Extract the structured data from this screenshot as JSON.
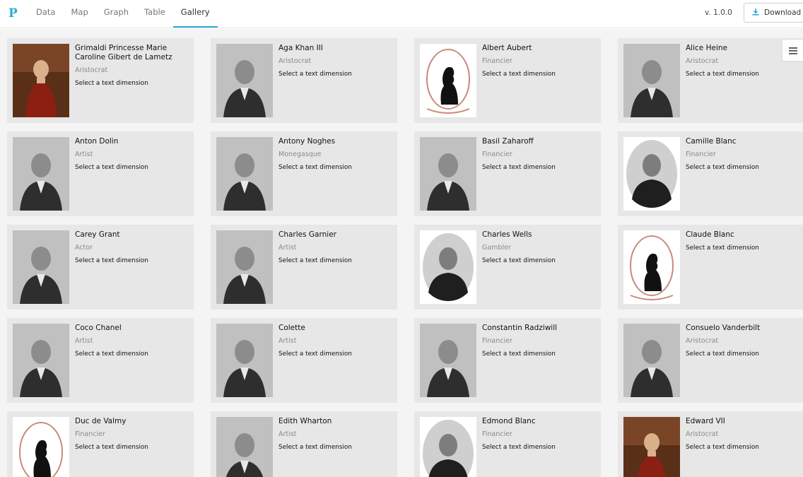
{
  "app": {
    "logo_text": "P",
    "version": "v. 1.0.0",
    "download_label": "Download",
    "accent_color": "#2ea8d8"
  },
  "nav": {
    "tabs": [
      {
        "label": "Data",
        "active": false
      },
      {
        "label": "Map",
        "active": false
      },
      {
        "label": "Graph",
        "active": false
      },
      {
        "label": "Table",
        "active": false
      },
      {
        "label": "Gallery",
        "active": true
      }
    ]
  },
  "gallery": {
    "dim_label": "Select a text dimension",
    "cards": [
      {
        "name": "Grimaldi Princesse Marie Caroline Gibert de Lametz",
        "role": "Aristocrat",
        "image": "painting-portrait"
      },
      {
        "name": "Aga Khan III",
        "role": "Aristocrat",
        "image": "photo-portrait"
      },
      {
        "name": "Albert Aubert",
        "role": "Financier",
        "image": "silhouette-placeholder"
      },
      {
        "name": "Alice Heine",
        "role": "Aristocrat",
        "image": "photo-portrait"
      },
      {
        "name": "Anton Dolin",
        "role": "Artist",
        "image": "photo-portrait"
      },
      {
        "name": "Antony Noghes",
        "role": "Monegasque",
        "image": "photo-portrait"
      },
      {
        "name": "Basil Zaharoff",
        "role": "Financier",
        "image": "photo-portrait"
      },
      {
        "name": "Camille Blanc",
        "role": "Financier",
        "image": "oval-portrait"
      },
      {
        "name": "Carey Grant",
        "role": "Actor",
        "image": "photo-portrait"
      },
      {
        "name": "Charles Garnier",
        "role": "Artist",
        "image": "photo-portrait"
      },
      {
        "name": "Charles Wells",
        "role": "Gambler",
        "image": "oval-portrait"
      },
      {
        "name": "Claude Blanc",
        "role": "",
        "image": "silhouette-placeholder"
      },
      {
        "name": "Coco Chanel",
        "role": "Artist",
        "image": "photo-portrait"
      },
      {
        "name": "Colette",
        "role": "Artist",
        "image": "photo-portrait"
      },
      {
        "name": "Constantin Radziwill",
        "role": "Financier",
        "image": "photo-portrait"
      },
      {
        "name": "Consuelo Vanderbilt",
        "role": "Aristocrat",
        "image": "photo-portrait"
      },
      {
        "name": "Duc de Valmy",
        "role": "Financier",
        "image": "silhouette-placeholder"
      },
      {
        "name": "Edith Wharton",
        "role": "Artist",
        "image": "photo-portrait"
      },
      {
        "name": "Edmond Blanc",
        "role": "Financier",
        "image": "oval-portrait"
      },
      {
        "name": "Edward VII",
        "role": "Aristocrat",
        "image": "painting-portrait"
      }
    ]
  }
}
